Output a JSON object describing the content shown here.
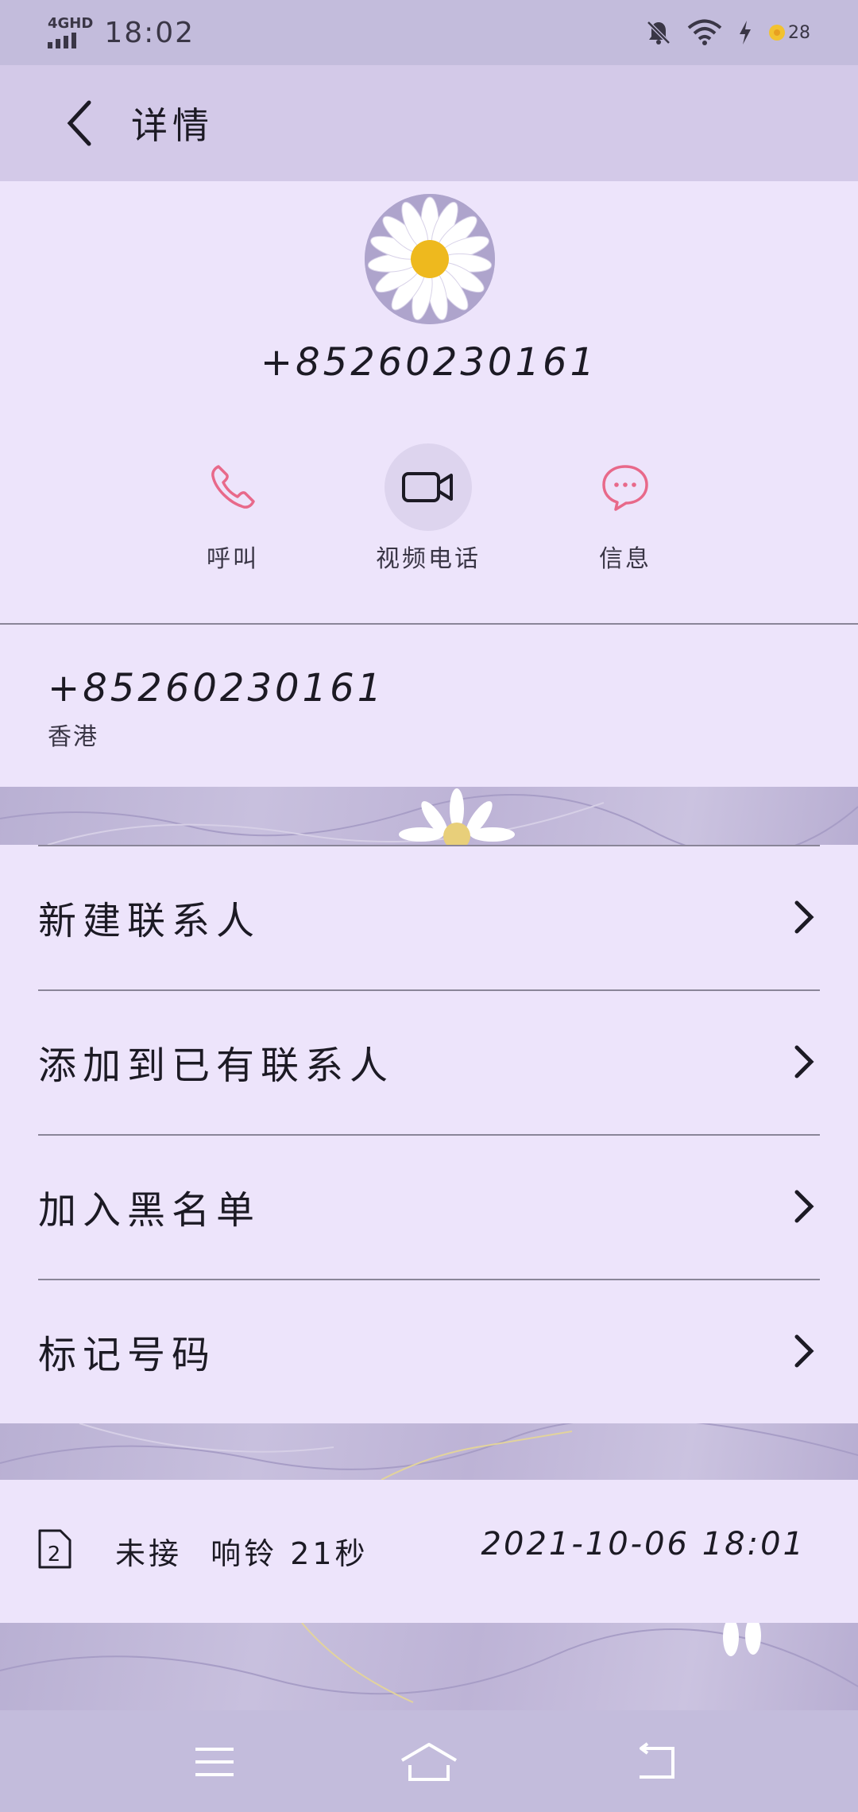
{
  "status_bar": {
    "network": "4GHD",
    "time": "18:02",
    "battery": "28",
    "icons": [
      "signal-icon",
      "mute-bell-icon",
      "wifi-icon",
      "charging-icon",
      "battery-icon"
    ]
  },
  "header": {
    "title": "详情",
    "back_icon": "chevron-left-icon"
  },
  "contact": {
    "avatar": "daisy-avatar",
    "number": "+85260230161"
  },
  "actions": [
    {
      "label": "呼叫",
      "icon": "phone-icon"
    },
    {
      "label": "视频电话",
      "icon": "video-camera-icon"
    },
    {
      "label": "信息",
      "icon": "message-bubble-icon"
    }
  ],
  "phone_detail": {
    "number": "+85260230161",
    "region": "香港"
  },
  "options": [
    {
      "label": "新建联系人"
    },
    {
      "label": "添加到已有联系人"
    },
    {
      "label": "加入黑名单"
    },
    {
      "label": "标记号码"
    }
  ],
  "call_log": {
    "sim": "2",
    "status": "未接",
    "ring": "响铃 21秒",
    "datetime": "2021-10-06 18:01"
  },
  "colors": {
    "accent_pink": "#e8698a",
    "panel": "#ede4fb",
    "header": "#d3c9e8"
  }
}
